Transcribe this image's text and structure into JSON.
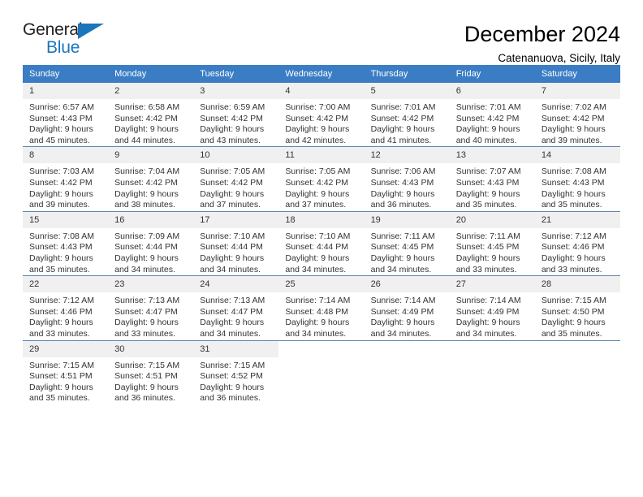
{
  "logo": {
    "word_top": "General",
    "word_bottom": "Blue",
    "triangle_color": "#1b75bb"
  },
  "header": {
    "title": "December 2024",
    "subtitle": "Catenanuova, Sicily, Italy"
  },
  "theme": {
    "header_bg": "#3b7dc4",
    "daynum_bg": "#f0f0f0",
    "row_divider": "#5b86b5"
  },
  "weekdays": [
    "Sunday",
    "Monday",
    "Tuesday",
    "Wednesday",
    "Thursday",
    "Friday",
    "Saturday"
  ],
  "labels": {
    "sunrise": "Sunrise:",
    "sunset": "Sunset:",
    "daylight": "Daylight:"
  },
  "weeks": [
    [
      {
        "day": "1",
        "sunrise": "Sunrise: 6:57 AM",
        "sunset": "Sunset: 4:43 PM",
        "daylight_1": "Daylight: 9 hours",
        "daylight_2": "and 45 minutes."
      },
      {
        "day": "2",
        "sunrise": "Sunrise: 6:58 AM",
        "sunset": "Sunset: 4:42 PM",
        "daylight_1": "Daylight: 9 hours",
        "daylight_2": "and 44 minutes."
      },
      {
        "day": "3",
        "sunrise": "Sunrise: 6:59 AM",
        "sunset": "Sunset: 4:42 PM",
        "daylight_1": "Daylight: 9 hours",
        "daylight_2": "and 43 minutes."
      },
      {
        "day": "4",
        "sunrise": "Sunrise: 7:00 AM",
        "sunset": "Sunset: 4:42 PM",
        "daylight_1": "Daylight: 9 hours",
        "daylight_2": "and 42 minutes."
      },
      {
        "day": "5",
        "sunrise": "Sunrise: 7:01 AM",
        "sunset": "Sunset: 4:42 PM",
        "daylight_1": "Daylight: 9 hours",
        "daylight_2": "and 41 minutes."
      },
      {
        "day": "6",
        "sunrise": "Sunrise: 7:01 AM",
        "sunset": "Sunset: 4:42 PM",
        "daylight_1": "Daylight: 9 hours",
        "daylight_2": "and 40 minutes."
      },
      {
        "day": "7",
        "sunrise": "Sunrise: 7:02 AM",
        "sunset": "Sunset: 4:42 PM",
        "daylight_1": "Daylight: 9 hours",
        "daylight_2": "and 39 minutes."
      }
    ],
    [
      {
        "day": "8",
        "sunrise": "Sunrise: 7:03 AM",
        "sunset": "Sunset: 4:42 PM",
        "daylight_1": "Daylight: 9 hours",
        "daylight_2": "and 39 minutes."
      },
      {
        "day": "9",
        "sunrise": "Sunrise: 7:04 AM",
        "sunset": "Sunset: 4:42 PM",
        "daylight_1": "Daylight: 9 hours",
        "daylight_2": "and 38 minutes."
      },
      {
        "day": "10",
        "sunrise": "Sunrise: 7:05 AM",
        "sunset": "Sunset: 4:42 PM",
        "daylight_1": "Daylight: 9 hours",
        "daylight_2": "and 37 minutes."
      },
      {
        "day": "11",
        "sunrise": "Sunrise: 7:05 AM",
        "sunset": "Sunset: 4:42 PM",
        "daylight_1": "Daylight: 9 hours",
        "daylight_2": "and 37 minutes."
      },
      {
        "day": "12",
        "sunrise": "Sunrise: 7:06 AM",
        "sunset": "Sunset: 4:43 PM",
        "daylight_1": "Daylight: 9 hours",
        "daylight_2": "and 36 minutes."
      },
      {
        "day": "13",
        "sunrise": "Sunrise: 7:07 AM",
        "sunset": "Sunset: 4:43 PM",
        "daylight_1": "Daylight: 9 hours",
        "daylight_2": "and 35 minutes."
      },
      {
        "day": "14",
        "sunrise": "Sunrise: 7:08 AM",
        "sunset": "Sunset: 4:43 PM",
        "daylight_1": "Daylight: 9 hours",
        "daylight_2": "and 35 minutes."
      }
    ],
    [
      {
        "day": "15",
        "sunrise": "Sunrise: 7:08 AM",
        "sunset": "Sunset: 4:43 PM",
        "daylight_1": "Daylight: 9 hours",
        "daylight_2": "and 35 minutes."
      },
      {
        "day": "16",
        "sunrise": "Sunrise: 7:09 AM",
        "sunset": "Sunset: 4:44 PM",
        "daylight_1": "Daylight: 9 hours",
        "daylight_2": "and 34 minutes."
      },
      {
        "day": "17",
        "sunrise": "Sunrise: 7:10 AM",
        "sunset": "Sunset: 4:44 PM",
        "daylight_1": "Daylight: 9 hours",
        "daylight_2": "and 34 minutes."
      },
      {
        "day": "18",
        "sunrise": "Sunrise: 7:10 AM",
        "sunset": "Sunset: 4:44 PM",
        "daylight_1": "Daylight: 9 hours",
        "daylight_2": "and 34 minutes."
      },
      {
        "day": "19",
        "sunrise": "Sunrise: 7:11 AM",
        "sunset": "Sunset: 4:45 PM",
        "daylight_1": "Daylight: 9 hours",
        "daylight_2": "and 34 minutes."
      },
      {
        "day": "20",
        "sunrise": "Sunrise: 7:11 AM",
        "sunset": "Sunset: 4:45 PM",
        "daylight_1": "Daylight: 9 hours",
        "daylight_2": "and 33 minutes."
      },
      {
        "day": "21",
        "sunrise": "Sunrise: 7:12 AM",
        "sunset": "Sunset: 4:46 PM",
        "daylight_1": "Daylight: 9 hours",
        "daylight_2": "and 33 minutes."
      }
    ],
    [
      {
        "day": "22",
        "sunrise": "Sunrise: 7:12 AM",
        "sunset": "Sunset: 4:46 PM",
        "daylight_1": "Daylight: 9 hours",
        "daylight_2": "and 33 minutes."
      },
      {
        "day": "23",
        "sunrise": "Sunrise: 7:13 AM",
        "sunset": "Sunset: 4:47 PM",
        "daylight_1": "Daylight: 9 hours",
        "daylight_2": "and 33 minutes."
      },
      {
        "day": "24",
        "sunrise": "Sunrise: 7:13 AM",
        "sunset": "Sunset: 4:47 PM",
        "daylight_1": "Daylight: 9 hours",
        "daylight_2": "and 34 minutes."
      },
      {
        "day": "25",
        "sunrise": "Sunrise: 7:14 AM",
        "sunset": "Sunset: 4:48 PM",
        "daylight_1": "Daylight: 9 hours",
        "daylight_2": "and 34 minutes."
      },
      {
        "day": "26",
        "sunrise": "Sunrise: 7:14 AM",
        "sunset": "Sunset: 4:49 PM",
        "daylight_1": "Daylight: 9 hours",
        "daylight_2": "and 34 minutes."
      },
      {
        "day": "27",
        "sunrise": "Sunrise: 7:14 AM",
        "sunset": "Sunset: 4:49 PM",
        "daylight_1": "Daylight: 9 hours",
        "daylight_2": "and 34 minutes."
      },
      {
        "day": "28",
        "sunrise": "Sunrise: 7:15 AM",
        "sunset": "Sunset: 4:50 PM",
        "daylight_1": "Daylight: 9 hours",
        "daylight_2": "and 35 minutes."
      }
    ],
    [
      {
        "day": "29",
        "sunrise": "Sunrise: 7:15 AM",
        "sunset": "Sunset: 4:51 PM",
        "daylight_1": "Daylight: 9 hours",
        "daylight_2": "and 35 minutes."
      },
      {
        "day": "30",
        "sunrise": "Sunrise: 7:15 AM",
        "sunset": "Sunset: 4:51 PM",
        "daylight_1": "Daylight: 9 hours",
        "daylight_2": "and 36 minutes."
      },
      {
        "day": "31",
        "sunrise": "Sunrise: 7:15 AM",
        "sunset": "Sunset: 4:52 PM",
        "daylight_1": "Daylight: 9 hours",
        "daylight_2": "and 36 minutes."
      },
      {
        "day": "",
        "sunrise": "",
        "sunset": "",
        "daylight_1": "",
        "daylight_2": ""
      },
      {
        "day": "",
        "sunrise": "",
        "sunset": "",
        "daylight_1": "",
        "daylight_2": ""
      },
      {
        "day": "",
        "sunrise": "",
        "sunset": "",
        "daylight_1": "",
        "daylight_2": ""
      },
      {
        "day": "",
        "sunrise": "",
        "sunset": "",
        "daylight_1": "",
        "daylight_2": ""
      }
    ]
  ]
}
